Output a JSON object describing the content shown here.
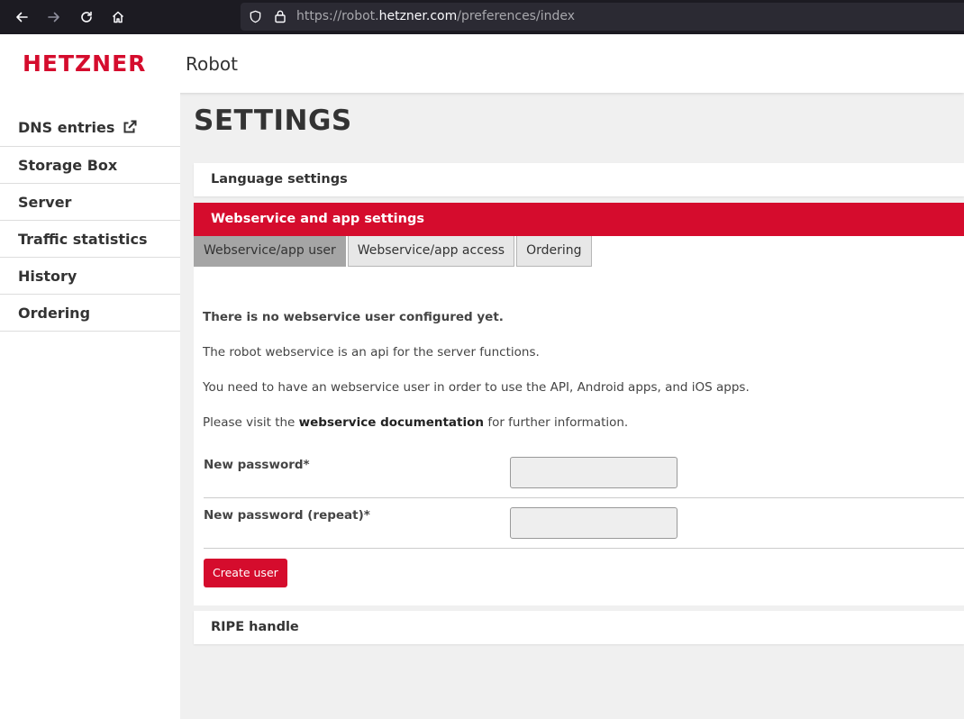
{
  "browser": {
    "url_prefix": "https://robot.",
    "url_domain": "hetzner.com",
    "url_path": "/preferences/index"
  },
  "header": {
    "logo": "HETZNER",
    "app_name": "Robot",
    "brand_color": "#d50c2d"
  },
  "sidebar": {
    "items": [
      {
        "label": "DNS entries",
        "icon": "external-link-icon"
      },
      {
        "label": "Storage Box"
      },
      {
        "label": "Server"
      },
      {
        "label": "Traffic statistics"
      },
      {
        "label": "History"
      },
      {
        "label": "Ordering"
      }
    ]
  },
  "main": {
    "title": "SETTINGS",
    "sections": {
      "language": "Language settings",
      "webservice": "Webservice and app settings",
      "ripe": "RIPE handle"
    },
    "tabs": [
      "Webservice/app user",
      "Webservice/app access",
      "Ordering"
    ],
    "active_tab": "Webservice/app user",
    "messages": {
      "no_user": "There is no webservice user configured yet.",
      "api_info": "The robot webservice is an api for the server functions.",
      "need_user": "You need to have an webservice user in order to use the API, Android apps, and iOS apps.",
      "visit_prefix": "Please visit the",
      "visit_link": "webservice documentation",
      "visit_suffix": "for further information."
    },
    "form": {
      "new_password_label": "New password*",
      "new_password_value": "",
      "repeat_password_label": "New password (repeat)*",
      "repeat_password_value": "",
      "submit_label": "Create user"
    }
  }
}
